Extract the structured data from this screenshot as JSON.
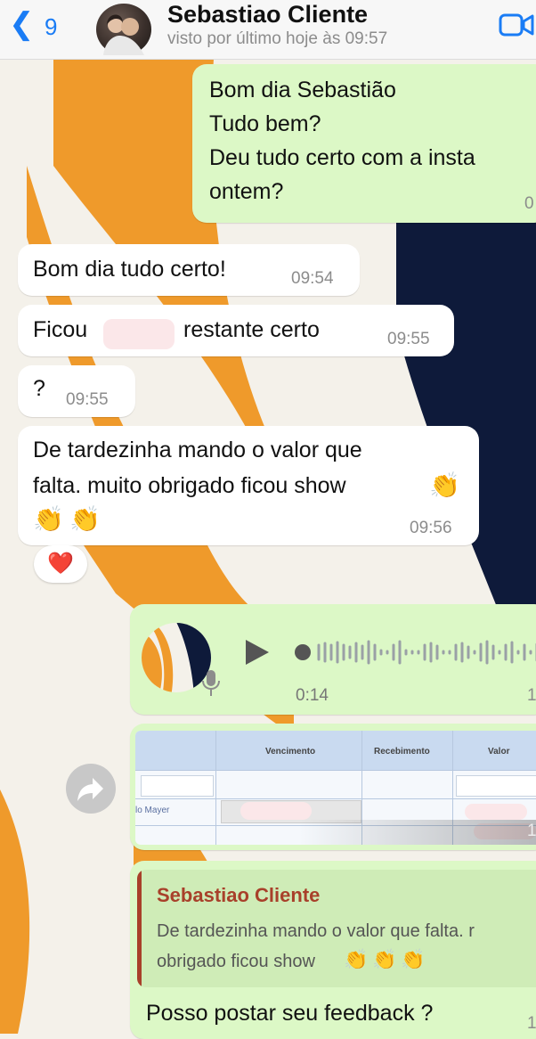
{
  "header": {
    "back_count": "9",
    "contact_name": "Sebastiao Cliente",
    "status": "visto por último hoje às 09:57"
  },
  "messages": {
    "m1_lines": [
      "Bom dia Sebastião",
      "Tudo bem?",
      "Deu tudo certo com a insta",
      "ontem?"
    ],
    "m1_time": "0",
    "m2_text": "Bom dia tudo certo!",
    "m2_time": "09:54",
    "m3_text_a": "Ficou",
    "m3_text_b": "restante certo",
    "m3_time": "09:55",
    "m4_text": "?",
    "m4_time": "09:55",
    "m5_line1": "De tardezinha mando o valor que",
    "m5_line2": "falta. muito obrigado ficou show",
    "m5_time": "09:56",
    "reaction": "❤️",
    "emoji_clap": "👏",
    "voice_duration": "0:14",
    "voice_time": "1",
    "sheet_cols": [
      "Vencimento",
      "Recebimento",
      "Valor"
    ],
    "sheet_row_label": "lo Mayer",
    "sheet_time": "1",
    "quote_author": "Sebastiao Cliente",
    "quote_line1": "De tardezinha mando o valor que falta. r",
    "quote_line2": "obrigado ficou show",
    "m8_text": "Posso postar seu feedback ?",
    "m8_time": "1"
  },
  "colors": {
    "orange": "#ef9a2b",
    "navy": "#0e1a3a",
    "bubble_out": "#dcf8c6",
    "accent_blue": "#1a7cf5",
    "quote_author": "#a8402a"
  }
}
